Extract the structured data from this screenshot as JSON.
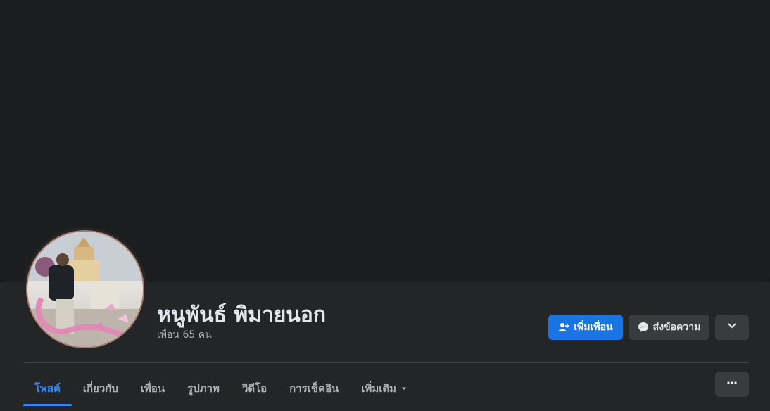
{
  "profile": {
    "name": "หนูพันธ์ พิมายนอก",
    "friends_count": "เพื่อน 65 คน"
  },
  "actions": {
    "add_friend_label": "เพิ่มเพื่อน",
    "message_label": "ส่งข้อความ"
  },
  "tabs": [
    {
      "label": "โพสต์",
      "active": true
    },
    {
      "label": "เกี่ยวกับ",
      "active": false
    },
    {
      "label": "เพื่อน",
      "active": false
    },
    {
      "label": "รูปภาพ",
      "active": false
    },
    {
      "label": "วิดีโอ",
      "active": false
    },
    {
      "label": "การเช็คอิน",
      "active": false
    },
    {
      "label": "เพิ่มเติม",
      "active": false
    }
  ],
  "icons": {
    "add_friend": "add-friend-icon",
    "messenger": "messenger-icon",
    "chevron": "chevron-down-icon",
    "more": "more-horizontal-icon",
    "tab_caret": "caret-down-icon"
  },
  "colors": {
    "accent": "#1b74e4",
    "active_tab": "#2d88ff",
    "background": "#18191a",
    "surface": "#242526",
    "button_secondary": "#3a3b3c"
  }
}
